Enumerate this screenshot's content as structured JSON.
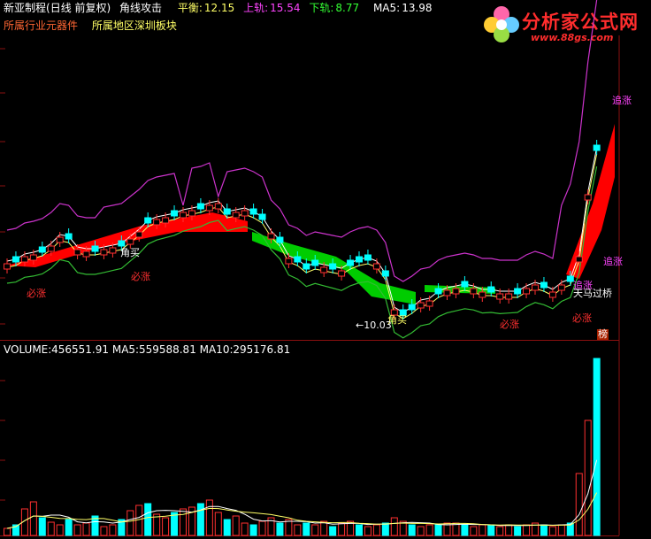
{
  "header": {
    "stock_name": "新亚制程",
    "period": "(日线 前复权)",
    "indicator": "角线攻击",
    "balance_label": "平衡:",
    "balance_value": "12.15",
    "upper_label": "上轨:",
    "upper_value": "15.54",
    "lower_label": "下轨:",
    "lower_value": "8.77",
    "ma5_label": "MA5:",
    "ma5_value": "13.98"
  },
  "subheader": {
    "industry": "所属行业元器件",
    "region": "所属地区深圳板块"
  },
  "volume_header": {
    "volume_label": "VOLUME:",
    "volume_value": "456551.91",
    "ma5_label": "MA5:",
    "ma5_value": "559588.81",
    "ma10_label": "MA10:",
    "ma10_value": "295176.81"
  },
  "logo": {
    "title": "分析家公式网",
    "url": "www.88gs.com"
  },
  "annotations": {
    "bizhang": "必涨",
    "jiaomai": "角买",
    "zhuizhang": "追涨",
    "tianma": "天马过桥",
    "low_price": "←10.03",
    "bang": "榜"
  },
  "colors": {
    "background": "#000000",
    "up_candle": "#ff3030",
    "down_candle": "#00ffff",
    "upper_band": "#cc33cc",
    "lower_band": "#33bb33",
    "balance_line": "#ffff66",
    "ma_line": "#ffffff",
    "fill_red": "#ff0000",
    "fill_green": "#00cc00",
    "label_red": "#ff3030",
    "label_yellow": "#ffff66",
    "label_pink": "#ff44ff",
    "label_white": "#ffffff"
  }
}
